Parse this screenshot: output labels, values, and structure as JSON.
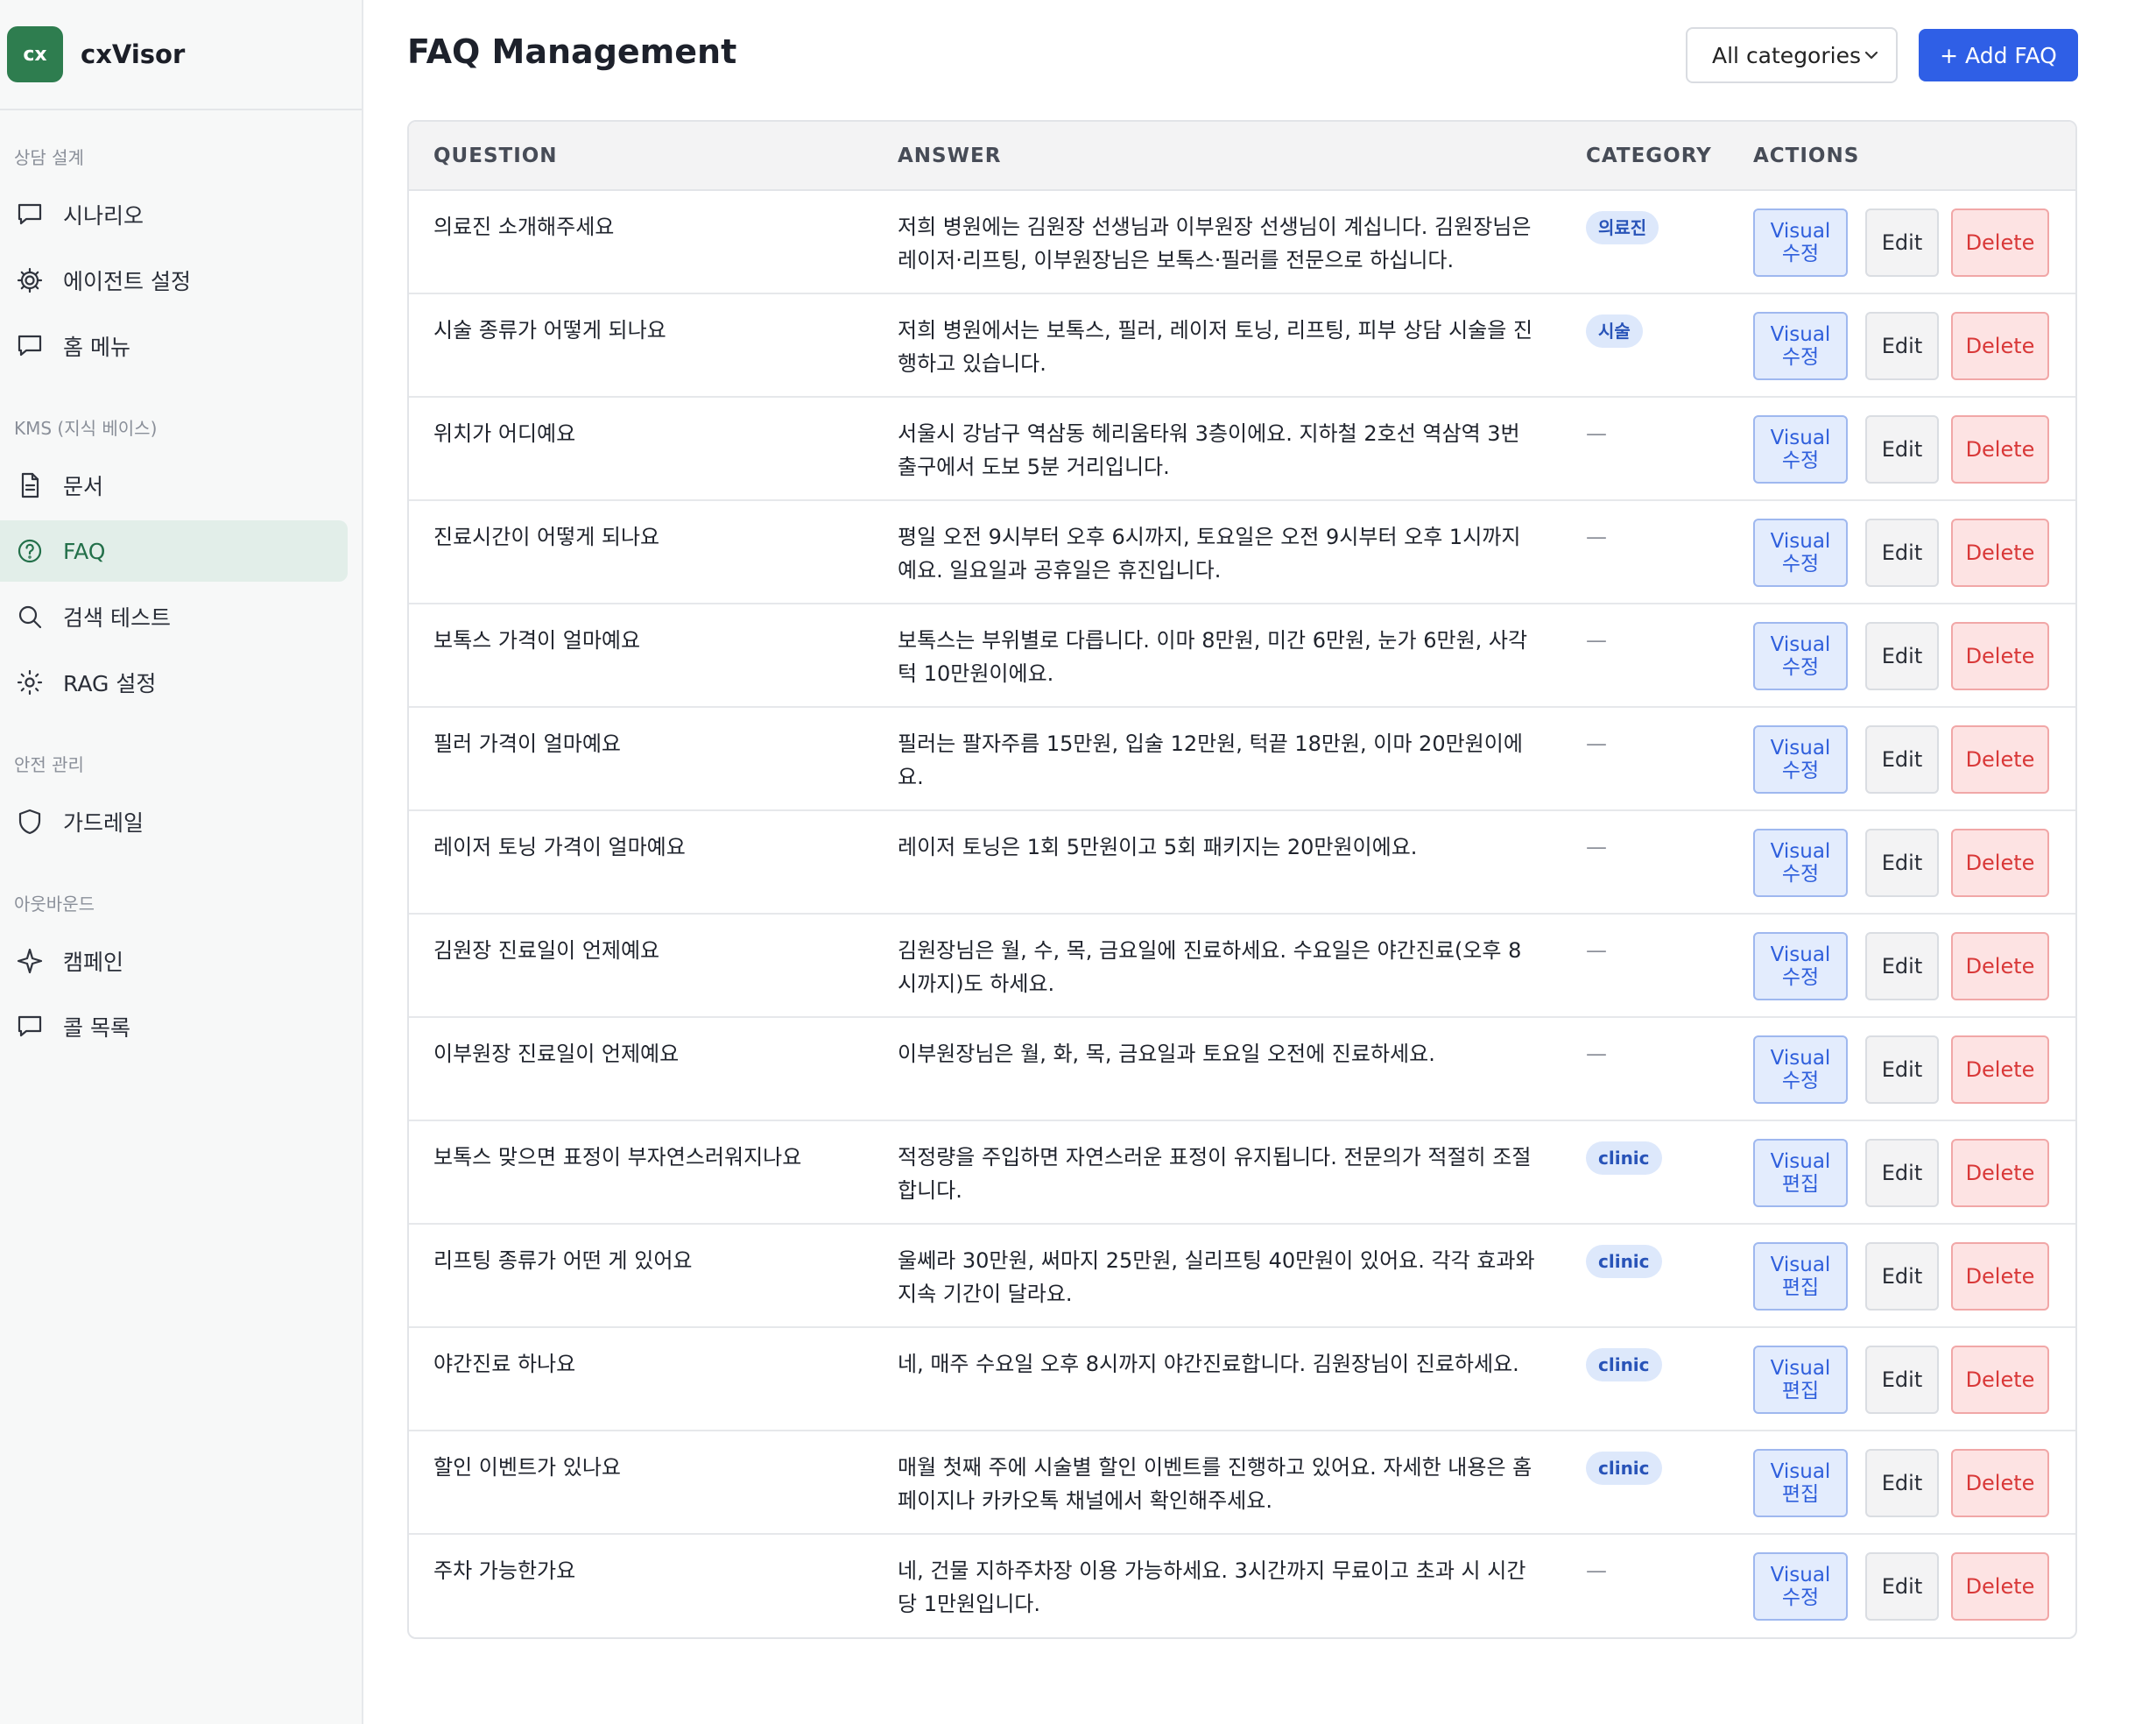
{
  "brand": {
    "logo_text": "cx",
    "name": "cxVisor"
  },
  "sidebar": {
    "groups": [
      {
        "heading": "상담 설계",
        "items": [
          {
            "label": "시나리오",
            "icon": "chat-bubble-icon"
          },
          {
            "label": "에이전트 설정",
            "icon": "gear-icon"
          },
          {
            "label": "홈 메뉴",
            "icon": "chat-bubble-icon"
          }
        ]
      },
      {
        "heading": "KMS (지식 베이스)",
        "items": [
          {
            "label": "문서",
            "icon": "document-icon"
          },
          {
            "label": "FAQ",
            "icon": "help-circle-icon",
            "active": true
          },
          {
            "label": "검색 테스트",
            "icon": "search-icon"
          },
          {
            "label": "RAG 설정",
            "icon": "sun-icon"
          }
        ]
      },
      {
        "heading": "안전 관리",
        "items": [
          {
            "label": "가드레일",
            "icon": "shield-icon"
          }
        ]
      },
      {
        "heading": "아웃바운드",
        "items": [
          {
            "label": "캠페인",
            "icon": "sparkle-icon"
          },
          {
            "label": "콜 목록",
            "icon": "chat-bubble-icon"
          }
        ]
      }
    ]
  },
  "header": {
    "title": "FAQ Management",
    "category_select": {
      "value": "All categories",
      "icon": "chevron-down-icon"
    },
    "add_button": "+ Add FAQ"
  },
  "table": {
    "columns": [
      "QUESTION",
      "ANSWER",
      "CATEGORY",
      "ACTIONS"
    ],
    "actions": {
      "edit": "Edit",
      "delete": "Delete"
    },
    "empty_category": "—",
    "rows": [
      {
        "question": "의료진 소개해주세요",
        "answer": "저희 병원에는 김원장 선생님과 이부원장 선생님이 계십니다. 김원장님은 레이저·리프팅, 이부원장님은 보톡스·필러를 전문으로 하십니다.",
        "category": "의료진",
        "visual_top": "Visual",
        "visual_bottom": "수정"
      },
      {
        "question": "시술 종류가 어떻게 되나요",
        "answer": "저희 병원에서는 보톡스, 필러, 레이저 토닝, 리프팅, 피부 상담 시술을 진행하고 있습니다.",
        "category": "시술",
        "visual_top": "Visual",
        "visual_bottom": "수정"
      },
      {
        "question": "위치가 어디예요",
        "answer": "서울시 강남구 역삼동 헤리움타워 3층이에요. 지하철 2호선 역삼역 3번 출구에서 도보 5분 거리입니다.",
        "category": "",
        "visual_top": "Visual",
        "visual_bottom": "수정"
      },
      {
        "question": "진료시간이 어떻게 되나요",
        "answer": "평일 오전 9시부터 오후 6시까지, 토요일은 오전 9시부터 오후 1시까지예요. 일요일과 공휴일은 휴진입니다.",
        "category": "",
        "visual_top": "Visual",
        "visual_bottom": "수정"
      },
      {
        "question": "보톡스 가격이 얼마예요",
        "answer": "보톡스는 부위별로 다릅니다. 이마 8만원, 미간 6만원, 눈가 6만원, 사각턱 10만원이에요.",
        "category": "",
        "visual_top": "Visual",
        "visual_bottom": "수정"
      },
      {
        "question": "필러 가격이 얼마예요",
        "answer": "필러는 팔자주름 15만원, 입술 12만원, 턱끝 18만원, 이마 20만원이에요.",
        "category": "",
        "visual_top": "Visual",
        "visual_bottom": "수정"
      },
      {
        "question": "레이저 토닝 가격이 얼마예요",
        "answer": "레이저 토닝은 1회 5만원이고 5회 패키지는 20만원이에요.",
        "category": "",
        "visual_top": "Visual",
        "visual_bottom": "수정"
      },
      {
        "question": "김원장 진료일이 언제예요",
        "answer": "김원장님은 월, 수, 목, 금요일에 진료하세요. 수요일은 야간진료(오후 8시까지)도 하세요.",
        "category": "",
        "visual_top": "Visual",
        "visual_bottom": "수정"
      },
      {
        "question": "이부원장 진료일이 언제예요",
        "answer": "이부원장님은 월, 화, 목, 금요일과 토요일 오전에 진료하세요.",
        "category": "",
        "visual_top": "Visual",
        "visual_bottom": "수정"
      },
      {
        "question": "보톡스 맞으면 표정이 부자연스러워지나요",
        "answer": "적정량을 주입하면 자연스러운 표정이 유지됩니다. 전문의가 적절히 조절합니다.",
        "category": "clinic",
        "visual_top": "Visual",
        "visual_bottom": "편집"
      },
      {
        "question": "리프팅 종류가 어떤 게 있어요",
        "answer": "울쎄라 30만원, 써마지 25만원, 실리프팅 40만원이 있어요. 각각 효과와 지속 기간이 달라요.",
        "category": "clinic",
        "visual_top": "Visual",
        "visual_bottom": "편집"
      },
      {
        "question": "야간진료 하나요",
        "answer": "네, 매주 수요일 오후 8시까지 야간진료합니다. 김원장님이 진료하세요.",
        "category": "clinic",
        "visual_top": "Visual",
        "visual_bottom": "편집"
      },
      {
        "question": "할인 이벤트가 있나요",
        "answer": "매월 첫째 주에 시술별 할인 이벤트를 진행하고 있어요. 자세한 내용은 홈페이지나 카카오톡 채널에서 확인해주세요.",
        "category": "clinic",
        "visual_top": "Visual",
        "visual_bottom": "편집"
      },
      {
        "question": "주차 가능한가요",
        "answer": "네, 건물 지하주차장 이용 가능하세요. 3시간까지 무료이고 초과 시 시간당 1만원입니다.",
        "category": "",
        "visual_top": "Visual",
        "visual_bottom": "수정"
      }
    ]
  },
  "colors": {
    "brand_green": "#2e7d4f",
    "primary_blue": "#2f5fe6",
    "delete_red": "#d93838",
    "active_nav_bg": "#e2eee9"
  }
}
